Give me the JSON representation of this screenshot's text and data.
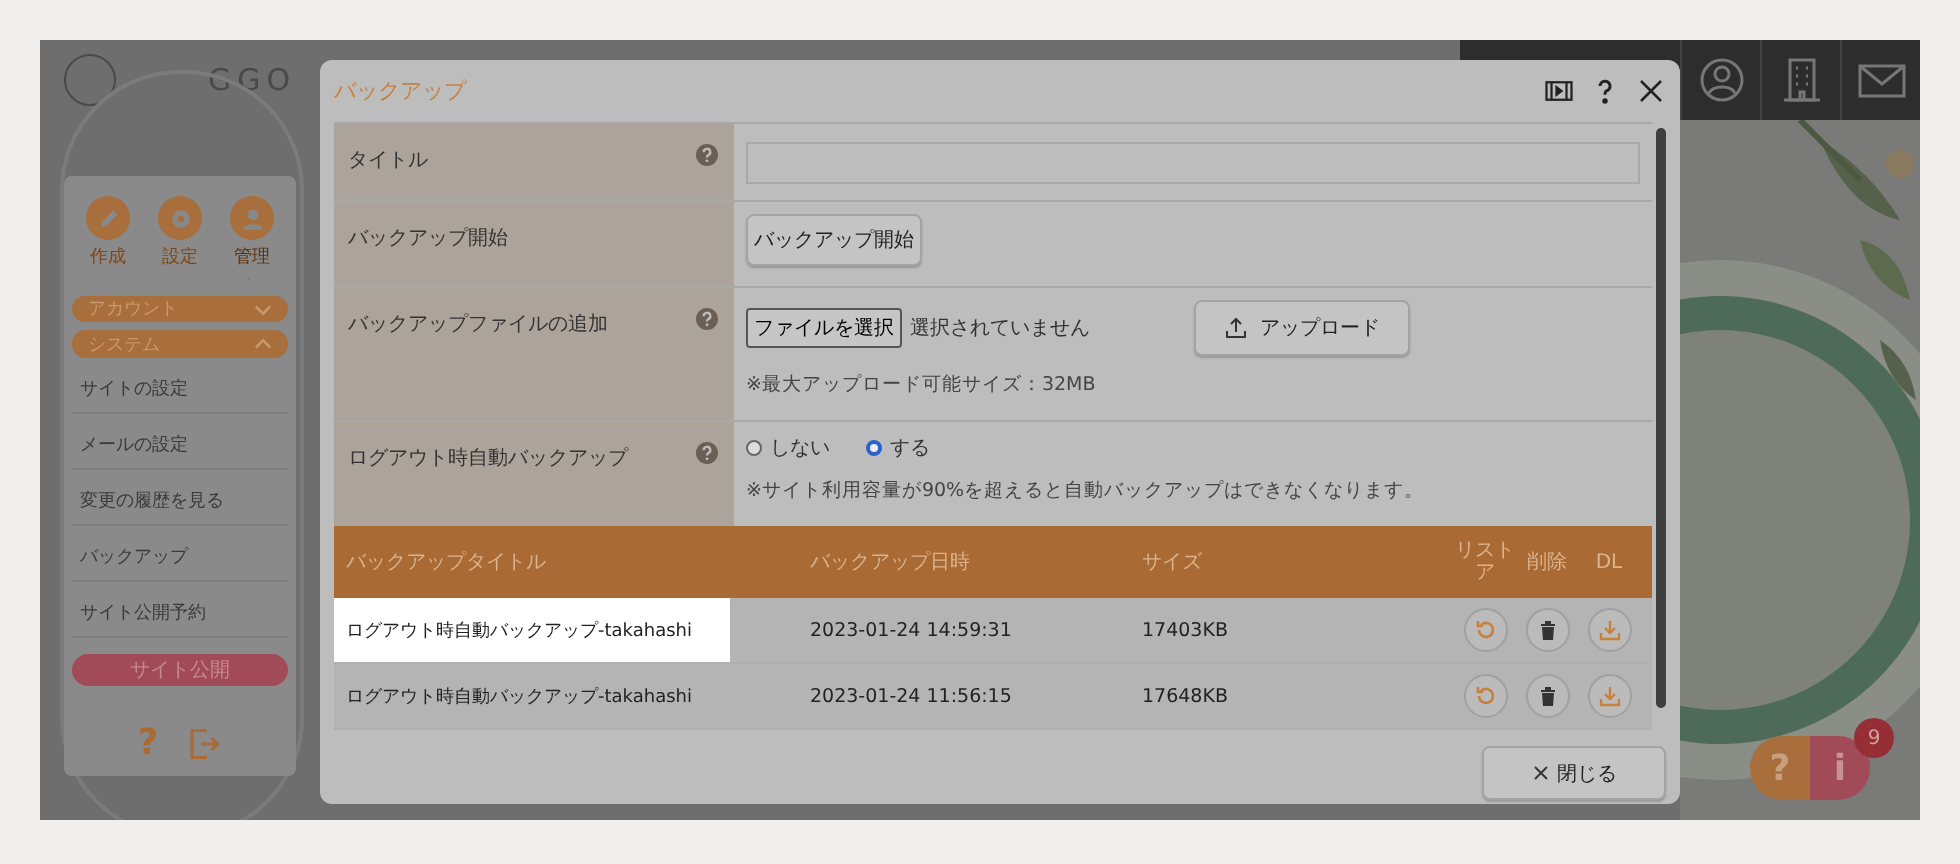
{
  "logo": {
    "text": "GGO"
  },
  "topbar": {
    "icons": [
      {
        "kind": "user"
      },
      {
        "kind": "building"
      },
      {
        "kind": "mail"
      }
    ]
  },
  "sidebar": {
    "tools": [
      {
        "label": "作成",
        "kind": "pen",
        "selected": false
      },
      {
        "label": "設定",
        "kind": "gear",
        "selected": false
      },
      {
        "label": "管理",
        "kind": "person",
        "selected": true
      }
    ],
    "sections": [
      {
        "label": "アカウント",
        "expanded": false
      },
      {
        "label": "システム",
        "expanded": true,
        "items": [
          "サイトの設定",
          "メールの設定",
          "変更の履歴を見る",
          "バックアップ",
          "サイト公開予約"
        ]
      }
    ],
    "publish_button": "サイト公開",
    "footer_icons": [
      {
        "kind": "help",
        "text": "?"
      },
      {
        "kind": "logout"
      }
    ]
  },
  "modal": {
    "title": "バックアップ",
    "form": [
      {
        "kind": "text",
        "label": "タイトル",
        "help": true
      },
      {
        "kind": "button",
        "label": "バックアップ開始",
        "help": false,
        "button": "バックアップ開始"
      },
      {
        "kind": "file",
        "label": "バックアップファイルの追加",
        "help": true,
        "file_button": "ファイルを選択",
        "file_status": "選択されていません",
        "upload_button": "アップロード",
        "note": "※最大アップロード可能サイズ：32MB"
      },
      {
        "kind": "radio",
        "label": "ログアウト時自動バックアップ",
        "help": true,
        "options": [
          {
            "label": "しない",
            "selected": false
          },
          {
            "label": "する",
            "selected": true
          }
        ],
        "note": "※サイト利用容量が90%を超えると自動バックアップはできなくなります。"
      }
    ],
    "table": {
      "columns": [
        "バックアップタイトル",
        "バックアップ日時",
        "サイズ",
        "リストア",
        "削除",
        "DL"
      ],
      "rows": [
        {
          "title": "ログアウト時自動バックアップ-takahashi",
          "date": "2023-01-24 14:59:31",
          "size": "17403KB",
          "selected": true
        },
        {
          "title": "ログアウト時自動バックアップ-takahashi",
          "date": "2023-01-24 11:56:15",
          "size": "17648KB",
          "selected": false
        }
      ]
    },
    "close_button": "閉じる"
  },
  "help_widget": {
    "help": "?",
    "info": "i",
    "badge": "9"
  }
}
